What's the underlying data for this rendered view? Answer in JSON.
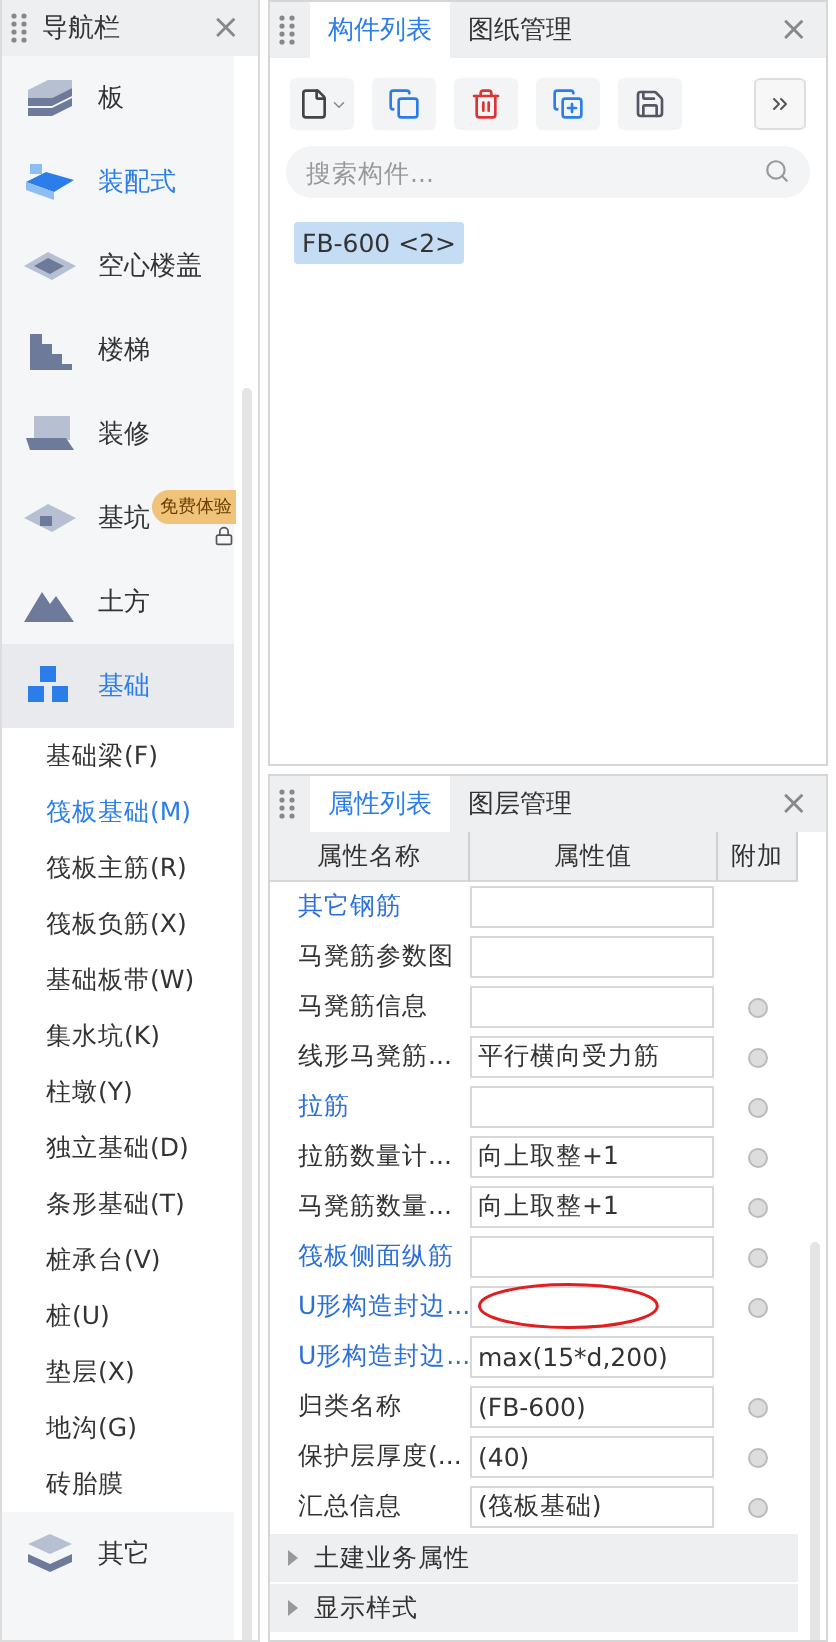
{
  "nav": {
    "title": "导航栏",
    "close": "×",
    "categories": [
      {
        "label": "板",
        "selected": false,
        "highlighted": false
      },
      {
        "label": "装配式",
        "selected": false,
        "highlighted": true
      },
      {
        "label": "空心楼盖",
        "selected": false,
        "highlighted": false
      },
      {
        "label": "楼梯",
        "selected": false,
        "highlighted": false
      },
      {
        "label": "装修",
        "selected": false,
        "highlighted": false
      },
      {
        "label": "基坑",
        "selected": false,
        "highlighted": false,
        "badge": "免费体验",
        "locked": true
      },
      {
        "label": "土方",
        "selected": false,
        "highlighted": false
      },
      {
        "label": "基础",
        "selected": true,
        "highlighted": false,
        "children": [
          {
            "label": "基础梁(F)",
            "selected": false
          },
          {
            "label": "筏板基础(M)",
            "selected": true
          },
          {
            "label": "筏板主筋(R)",
            "selected": false
          },
          {
            "label": "筏板负筋(X)",
            "selected": false
          },
          {
            "label": "基础板带(W)",
            "selected": false
          },
          {
            "label": "集水坑(K)",
            "selected": false
          },
          {
            "label": "柱墩(Y)",
            "selected": false
          },
          {
            "label": "独立基础(D)",
            "selected": false
          },
          {
            "label": "条形基础(T)",
            "selected": false
          },
          {
            "label": "桩承台(V)",
            "selected": false
          },
          {
            "label": "桩(U)",
            "selected": false
          },
          {
            "label": "垫层(X)",
            "selected": false
          },
          {
            "label": "地沟(G)",
            "selected": false
          },
          {
            "label": "砖胎膜",
            "selected": false
          }
        ]
      },
      {
        "label": "其它",
        "selected": false,
        "highlighted": false
      }
    ]
  },
  "components": {
    "tabs": [
      {
        "label": "构件列表",
        "selected": true
      },
      {
        "label": "图纸管理",
        "selected": false
      }
    ],
    "close": "×",
    "search": {
      "placeholder": "搜索构件..."
    },
    "items": [
      {
        "label": "FB-600 <2>",
        "selected": true
      }
    ]
  },
  "properties": {
    "tabs": [
      {
        "label": "属性列表",
        "selected": true
      },
      {
        "label": "图层管理",
        "selected": false
      }
    ],
    "close": "×",
    "columns": [
      "属性名称",
      "属性值",
      "附加"
    ],
    "rows": [
      {
        "name": "其它钢筋",
        "value": "",
        "link": true,
        "has_attach": false,
        "circled": false
      },
      {
        "name": "马凳筋参数图",
        "value": "",
        "link": false,
        "has_attach": false,
        "circled": false
      },
      {
        "name": "马凳筋信息",
        "value": "",
        "link": false,
        "has_attach": true,
        "circled": false
      },
      {
        "name": "线形马凳筋...",
        "value": "平行横向受力筋",
        "link": false,
        "has_attach": true,
        "circled": false
      },
      {
        "name": "拉筋",
        "value": "",
        "link": true,
        "has_attach": true,
        "circled": false
      },
      {
        "name": "拉筋数量计...",
        "value": "向上取整+1",
        "link": false,
        "has_attach": true,
        "circled": false
      },
      {
        "name": "马凳筋数量...",
        "value": "向上取整+1",
        "link": false,
        "has_attach": true,
        "circled": false
      },
      {
        "name": "筏板侧面纵筋",
        "value": "",
        "link": true,
        "has_attach": true,
        "circled": false
      },
      {
        "name": "U形构造封边...",
        "value": "",
        "link": true,
        "has_attach": true,
        "circled": true
      },
      {
        "name": "U形构造封边...",
        "value": "max(15*d,200)",
        "link": true,
        "has_attach": false,
        "circled": false
      },
      {
        "name": "归类名称",
        "value": "(FB-600)",
        "link": false,
        "has_attach": true,
        "circled": false
      },
      {
        "name": "保护层厚度(...",
        "value": "(40)",
        "link": false,
        "has_attach": true,
        "circled": false
      },
      {
        "name": "汇总信息",
        "value": "(筏板基础)",
        "link": false,
        "has_attach": true,
        "circled": false
      }
    ],
    "groups": [
      {
        "label": "土建业务属性",
        "expanded": false
      },
      {
        "label": "显示样式",
        "expanded": false
      }
    ]
  }
}
